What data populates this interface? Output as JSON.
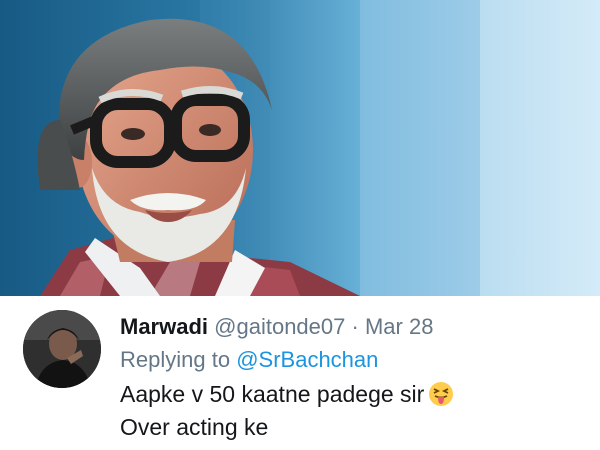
{
  "tweet": {
    "display_name": "Marwadi",
    "handle": "@gaitonde07",
    "separator": "·",
    "date": "Mar 28",
    "replying_prefix": "Replying to",
    "replying_to": "@SrBachchan",
    "line1": "Aapke v 50 kaatne padege sir",
    "line2": "Over acting ke",
    "emoji": "squinting-tongue-emoji"
  },
  "colors": {
    "primary_text": "#14171a",
    "secondary_text": "#657786",
    "link": "#1b95e0"
  }
}
